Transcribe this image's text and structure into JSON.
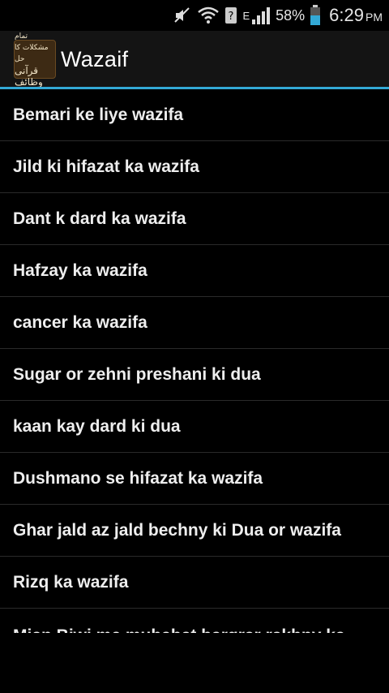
{
  "status_bar": {
    "network_type": "E",
    "battery_percent": "58%",
    "time": "6:29",
    "ampm": "PM"
  },
  "action_bar": {
    "app_icon_text_line1": "تمام مشکلات کا حل",
    "app_icon_text_line2": "قرآنی وظائف",
    "title": "Wazaif"
  },
  "colors": {
    "accent": "#33a9d6",
    "background": "#000000",
    "action_bar": "#141414"
  },
  "list": {
    "items": [
      "Bemari ke liye wazifa",
      "Jild ki hifazat ka wazifa",
      "Dant k dard ka wazifa",
      "Hafzay ka wazifa",
      "cancer ka wazifa",
      "Sugar or zehni preshani ki dua",
      "kaan kay dard ki dua",
      "Dushmano se hifazat ka wazifa",
      "Ghar jald az jald bechny ki Dua or wazifa",
      "Rizq ka wazifa",
      "Mian Biwi me muhabat barqrar rakhny ka"
    ]
  }
}
